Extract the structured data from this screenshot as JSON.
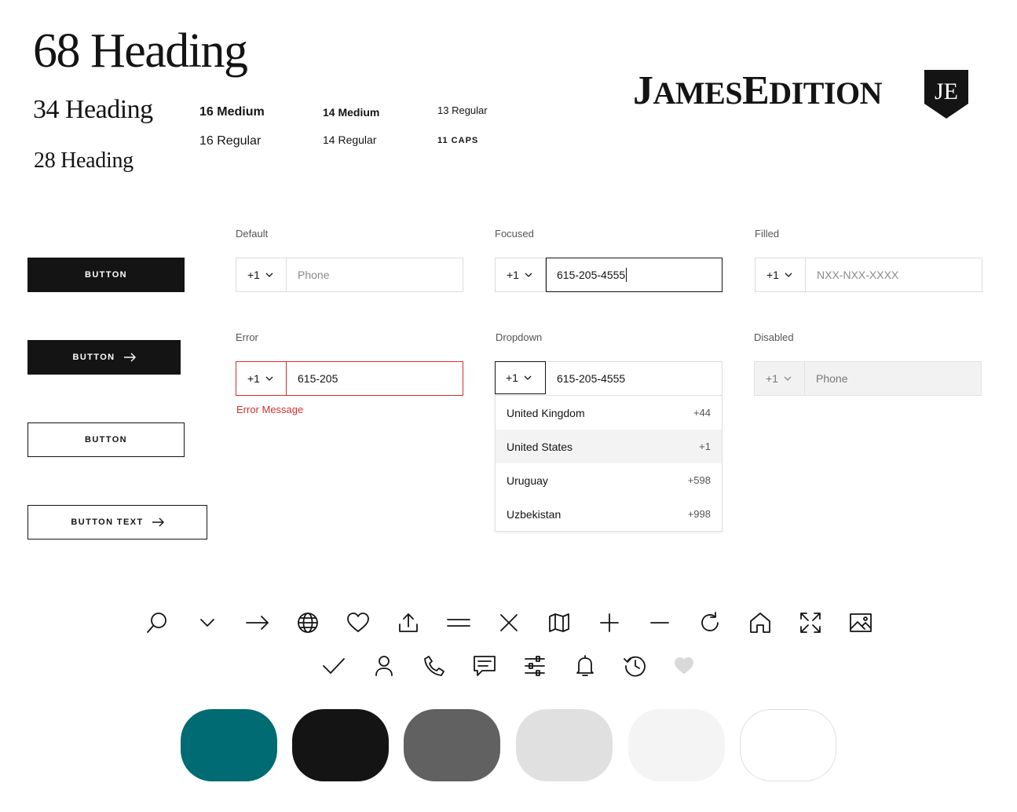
{
  "typography": {
    "h68": "68 Heading",
    "h34": "34 Heading",
    "h28": "28 Heading",
    "t16_medium": "16 Medium",
    "t16_regular": "16 Regular",
    "t14_medium": "14 Medium",
    "t14_regular": "14 Regular",
    "t13_regular": "13 Regular",
    "t11_caps": "11 CAPS"
  },
  "logo": {
    "word_parts": [
      "J",
      "AMES",
      "E",
      "DITION"
    ],
    "monogram": "JE"
  },
  "buttons": {
    "primary": "BUTTON",
    "primary_arrow": "BUTTON",
    "secondary": "BUTTON",
    "secondary_arrow": "BUTTON TEXT"
  },
  "fields": {
    "default": {
      "label": "Default",
      "code": "+1",
      "placeholder": "Phone"
    },
    "focused": {
      "label": "Focused",
      "code": "+1",
      "value": "615-205-4555"
    },
    "filled": {
      "label": "Filled",
      "code": "+1",
      "placeholder": "NXX-NXX-XXXX"
    },
    "error": {
      "label": "Error",
      "code": "+1",
      "value": "615-205",
      "message": "Error Message"
    },
    "dropdown": {
      "label": "Dropdown",
      "code": "+1",
      "value": "615-205-4555"
    },
    "disabled": {
      "label": "Disabled",
      "code": "+1",
      "placeholder": "Phone"
    }
  },
  "dropdown_options": [
    {
      "country": "United Kingdom",
      "code": "+44"
    },
    {
      "country": "United States",
      "code": "+1",
      "selected": true
    },
    {
      "country": "Uruguay",
      "code": "+598"
    },
    {
      "country": "Uzbekistan",
      "code": "+998"
    }
  ],
  "icons": {
    "row1": [
      "search",
      "chevron-down",
      "arrow-right",
      "globe",
      "heart",
      "upload",
      "menu",
      "close",
      "map",
      "plus",
      "minus",
      "refresh",
      "home",
      "expand",
      "image"
    ],
    "row2": [
      "check",
      "user",
      "phone",
      "chat",
      "filters",
      "bell",
      "history",
      "heart-filled"
    ]
  },
  "colors": {
    "teal": "#006b73",
    "black": "#141414",
    "gray_dark": "#616161",
    "gray_light": "#e0e0e0",
    "gray_lighter": "#f4f4f4",
    "white": "#ffffff",
    "error": "#d32f2f"
  }
}
